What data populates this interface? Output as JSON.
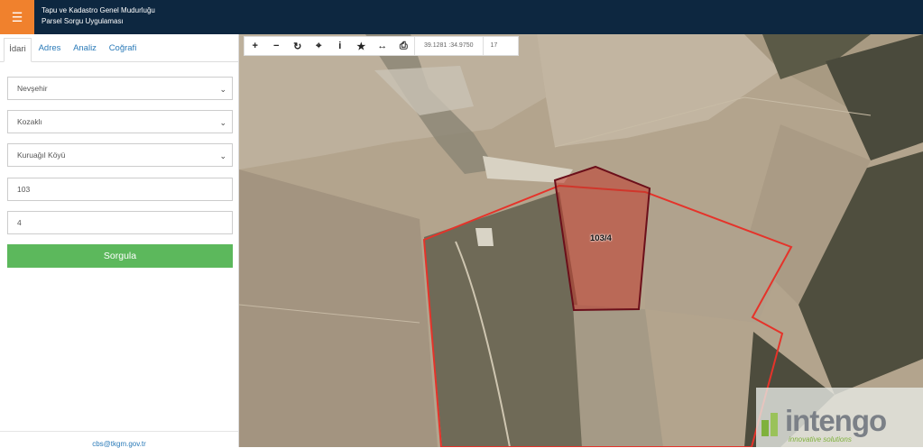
{
  "header": {
    "menu_icon": "hamburger-icon",
    "title_line1": "Tapu ve Kadastro Genel Mudurluğu",
    "title_line2": "Parsel Sorgu Uygulaması"
  },
  "sidebar": {
    "tabs": [
      {
        "label": "İdari",
        "active": true
      },
      {
        "label": "Adres",
        "active": false
      },
      {
        "label": "Analiz",
        "active": false
      },
      {
        "label": "Coğrafi",
        "active": false
      }
    ],
    "province_value": "Nevşehir",
    "district_value": "Kozaklı",
    "village_value": "Kuruağıl Köyü",
    "block_value": "103",
    "parcel_value": "4",
    "search_label": "Sorgula",
    "footer_email": "cbs@tkgm.gov.tr"
  },
  "map": {
    "toolbar_icons": [
      "zoom-in-icon",
      "zoom-out-icon",
      "refresh-icon",
      "locate-icon",
      "info-icon",
      "star-icon",
      "measure-icon",
      "print-icon"
    ],
    "coordinate": "39.1281 :34.9750",
    "zoom_level": "17",
    "parcel_label": "103/4",
    "parcel_fill": "#c0392b",
    "parcel_border": "#6b0f1a",
    "boundary_color": "#e5332a"
  },
  "logo": {
    "word": "intengo",
    "tagline": "innovative solutions"
  }
}
